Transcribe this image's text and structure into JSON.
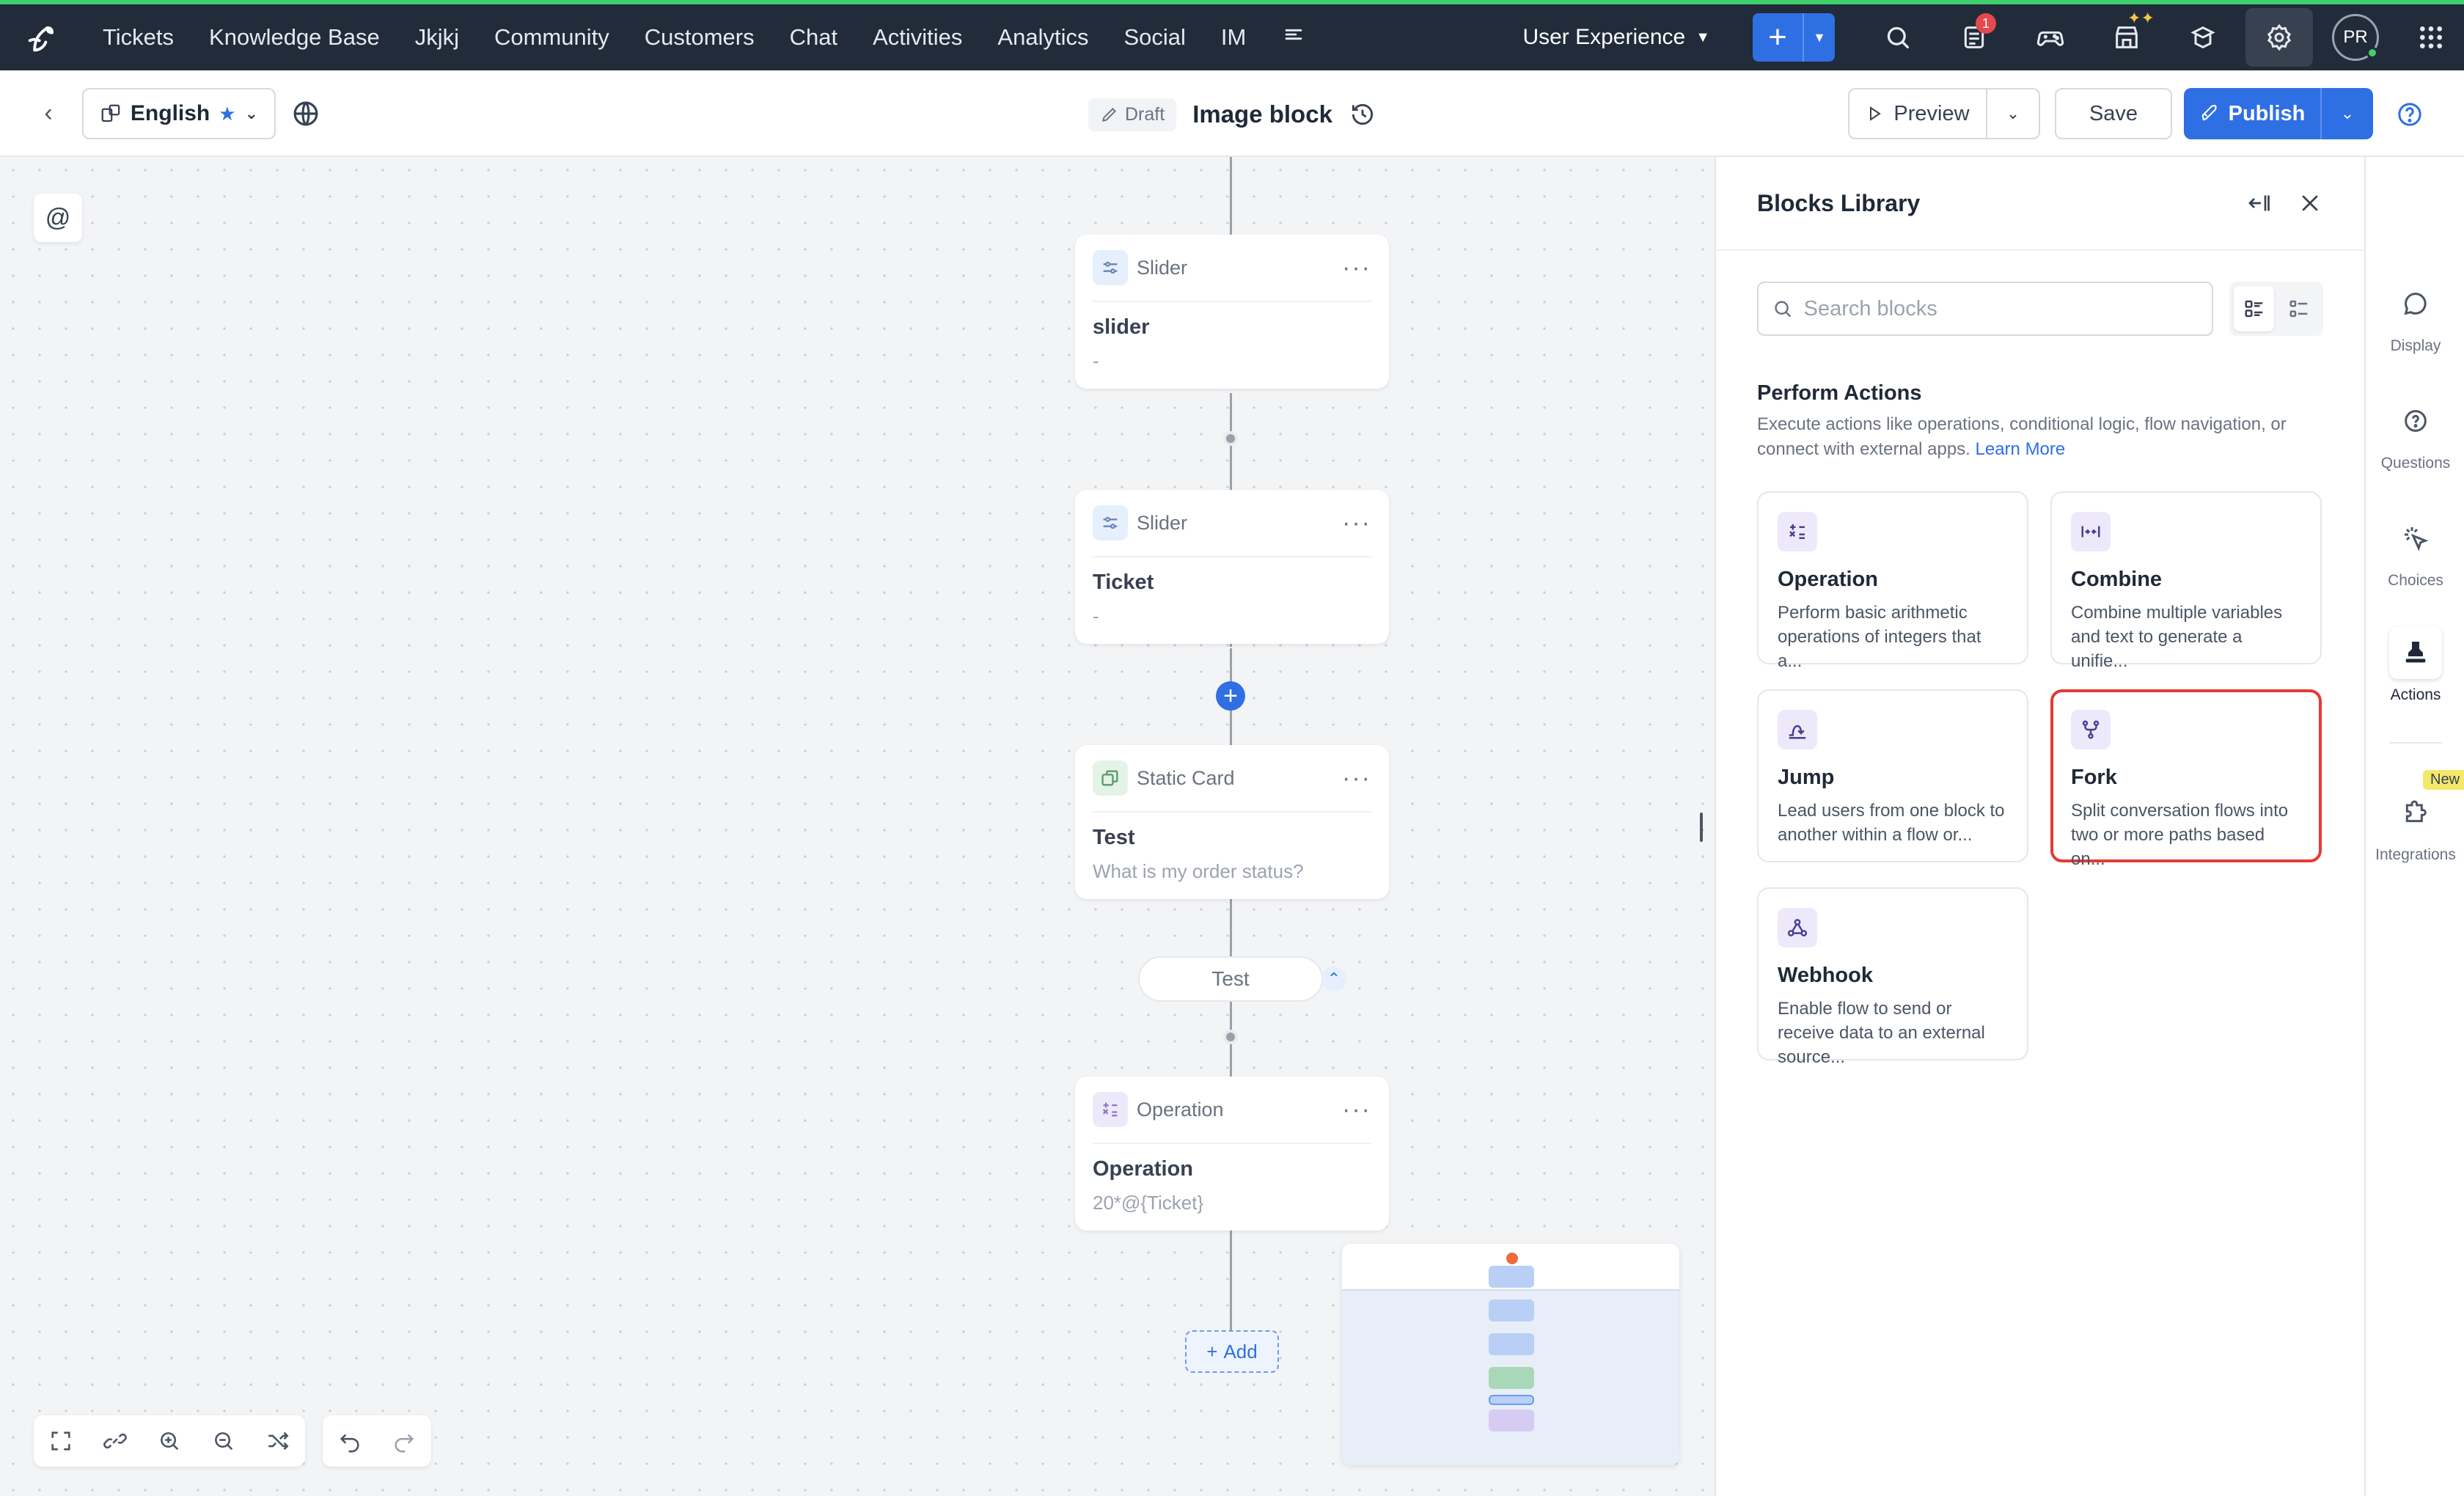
{
  "topnav": {
    "items": [
      "Tickets",
      "Knowledge Base",
      "Jkjkj",
      "Community",
      "Customers",
      "Chat",
      "Activities",
      "Analytics",
      "Social",
      "IM"
    ],
    "department": "User Experience",
    "notification_count": "1",
    "avatar_initials": "PR"
  },
  "subbar": {
    "language": "English",
    "status": "Draft",
    "title": "Image block",
    "preview_label": "Preview",
    "save_label": "Save",
    "publish_label": "Publish"
  },
  "canvas": {
    "mention_symbol": "@",
    "nodes": [
      {
        "type": "Slider",
        "title": "slider",
        "subtitle": "-"
      },
      {
        "type": "Slider",
        "title": "Ticket",
        "subtitle": "-"
      },
      {
        "type": "Static Card",
        "title": "Test",
        "subtitle": "What is my order status?"
      },
      {
        "type": "Operation",
        "title": "Operation",
        "subtitle": "20*@{Ticket}"
      }
    ],
    "choice_label": "Test",
    "add_label": "Add"
  },
  "library": {
    "title": "Blocks Library",
    "search_placeholder": "Search blocks",
    "section_title": "Perform Actions",
    "section_desc": "Execute actions like operations, conditional logic, flow navigation, or connect with external apps.",
    "learn_more": "Learn More",
    "blocks": [
      {
        "name": "Operation",
        "desc": "Perform basic arithmetic operations of integers that a...",
        "icon": "operation-icon"
      },
      {
        "name": "Combine",
        "desc": "Combine multiple variables and text to generate a unifie...",
        "icon": "combine-icon"
      },
      {
        "name": "Jump",
        "desc": "Lead users from one block to another within a flow or...",
        "icon": "jump-icon"
      },
      {
        "name": "Fork",
        "desc": "Split conversation flows into two or more paths based on...",
        "icon": "fork-icon"
      },
      {
        "name": "Webhook",
        "desc": "Enable flow to send or receive data to an external source...",
        "icon": "webhook-icon"
      }
    ]
  },
  "rail": {
    "items": [
      "Display",
      "Questions",
      "Choices",
      "Actions",
      "Integrations"
    ],
    "new_badge": "New"
  },
  "colors": {
    "nav_bg": "#222b3a",
    "accent": "#2f6fe4",
    "selected_border": "#e53935",
    "top_stripe": "#3ecf6b"
  }
}
